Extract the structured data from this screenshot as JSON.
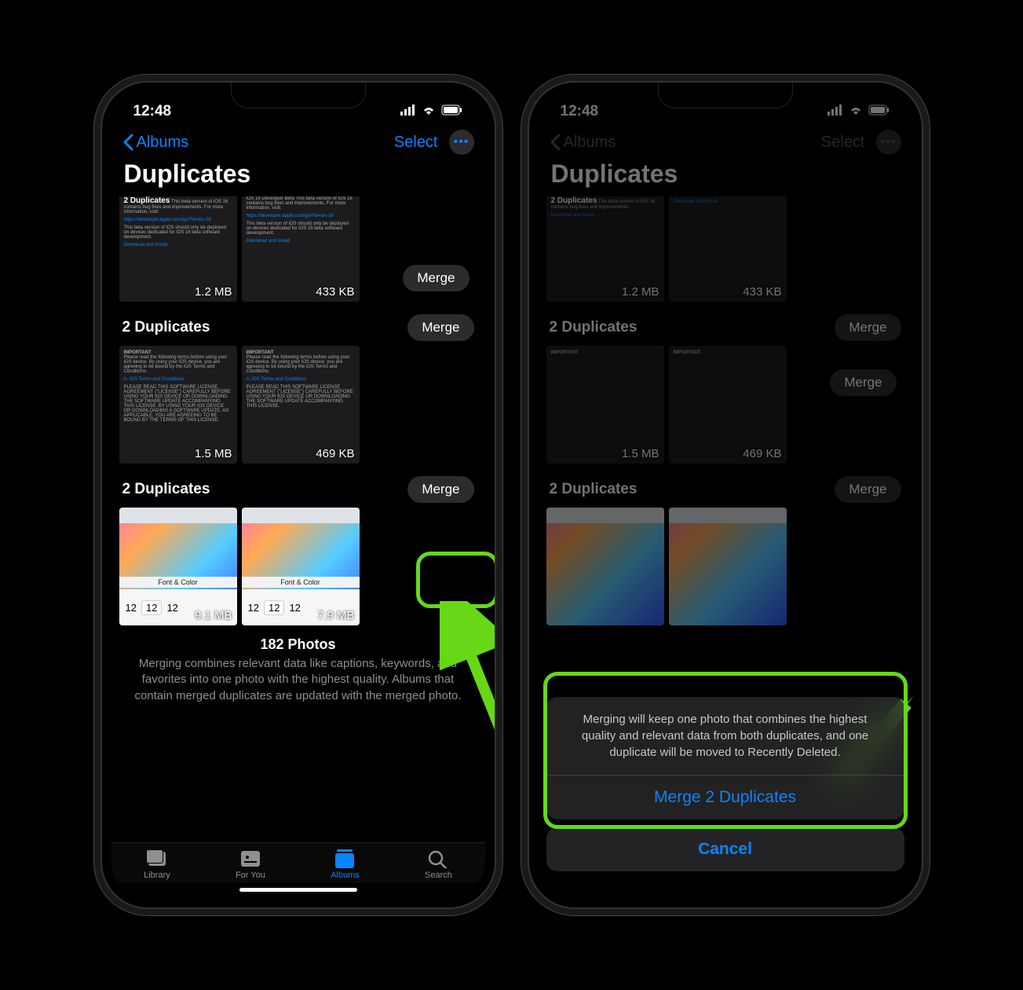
{
  "status": {
    "time": "12:48"
  },
  "nav": {
    "back": "Albums",
    "select": "Select"
  },
  "title": "Duplicates",
  "merge_label": "Merge",
  "groups": [
    {
      "title": "2 Duplicates",
      "sizes": [
        "1.2 MB",
        "433 KB"
      ]
    },
    {
      "title": "2 Duplicates",
      "sizes": [
        "1.5 MB",
        "469 KB"
      ]
    },
    {
      "title": "2 Duplicates",
      "sizes": [
        "9.1 MB",
        "7.9 MB"
      ]
    }
  ],
  "footer": {
    "count": "182 Photos",
    "desc": "Merging combines relevant data like captions, keywords, and favorites into one photo with the highest quality. Albums that contain merged duplicates are updated with the merged photo."
  },
  "tabs": {
    "library": "Library",
    "foryou": "For You",
    "albums": "Albums",
    "search": "Search"
  },
  "sheet": {
    "msg": "Merging will keep one photo that combines the highest quality and relevant data from both duplicates, and one duplicate will be moved to Recently Deleted.",
    "action": "Merge 2 Duplicates",
    "cancel": "Cancel"
  },
  "thumb": {
    "font_color": "Font & Color",
    "num": "12",
    "important": "IMPORTANT",
    "terms": "iOS Terms and Conditions",
    "dl": "Download and Install"
  }
}
